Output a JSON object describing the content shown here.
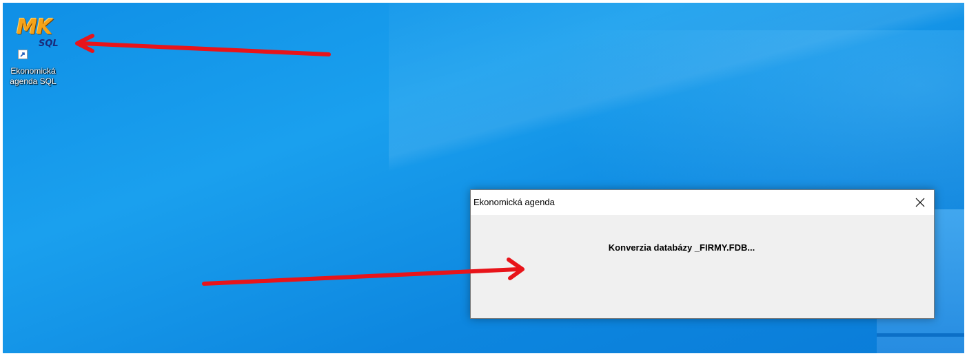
{
  "desktop": {
    "icon": {
      "logo_main": "MK",
      "logo_sub": "SQL",
      "label_line1": "Ekonomická",
      "label_line2": "agenda SQL"
    }
  },
  "dialog": {
    "title": "Ekonomická agenda",
    "close_glyph": "✕",
    "message": "Konverzia databázy _FIRMY.FDB..."
  },
  "annotations": {
    "arrow_color": "#e8141a"
  }
}
